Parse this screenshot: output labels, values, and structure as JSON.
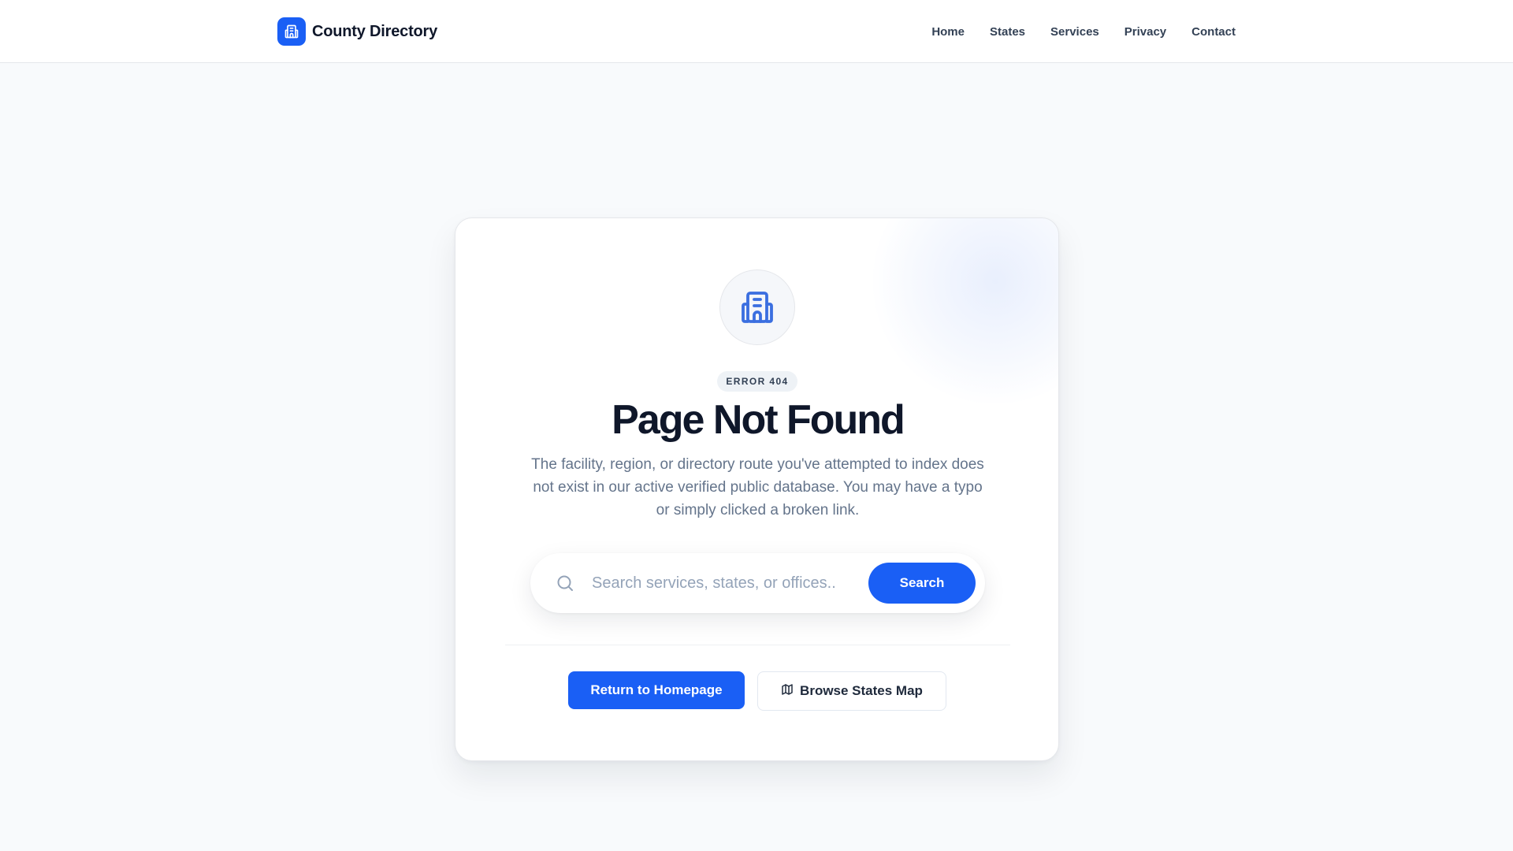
{
  "header": {
    "brand": "County Directory",
    "brand_icon": "building-icon",
    "nav": [
      "Home",
      "States",
      "Services",
      "Privacy",
      "Contact"
    ]
  },
  "main": {
    "icon": "building-icon",
    "badge": "ERROR 404",
    "title": "Page Not Found",
    "description": "The facility, region, or directory route you've attempted to index does not exist in our active verified public database. You may have a typo or simply clicked a broken link.",
    "search": {
      "placeholder": "Search services, states, or offices...",
      "value": "",
      "button": "Search",
      "icon": "search-icon"
    },
    "actions": {
      "primary": "Return to Homepage",
      "secondary": "Browse States Map",
      "secondary_icon": "map-icon"
    }
  },
  "colors": {
    "accent": "#1a5ff5",
    "background": "#f8fafc",
    "title": "#0f172a",
    "muted_text": "#64748b"
  }
}
